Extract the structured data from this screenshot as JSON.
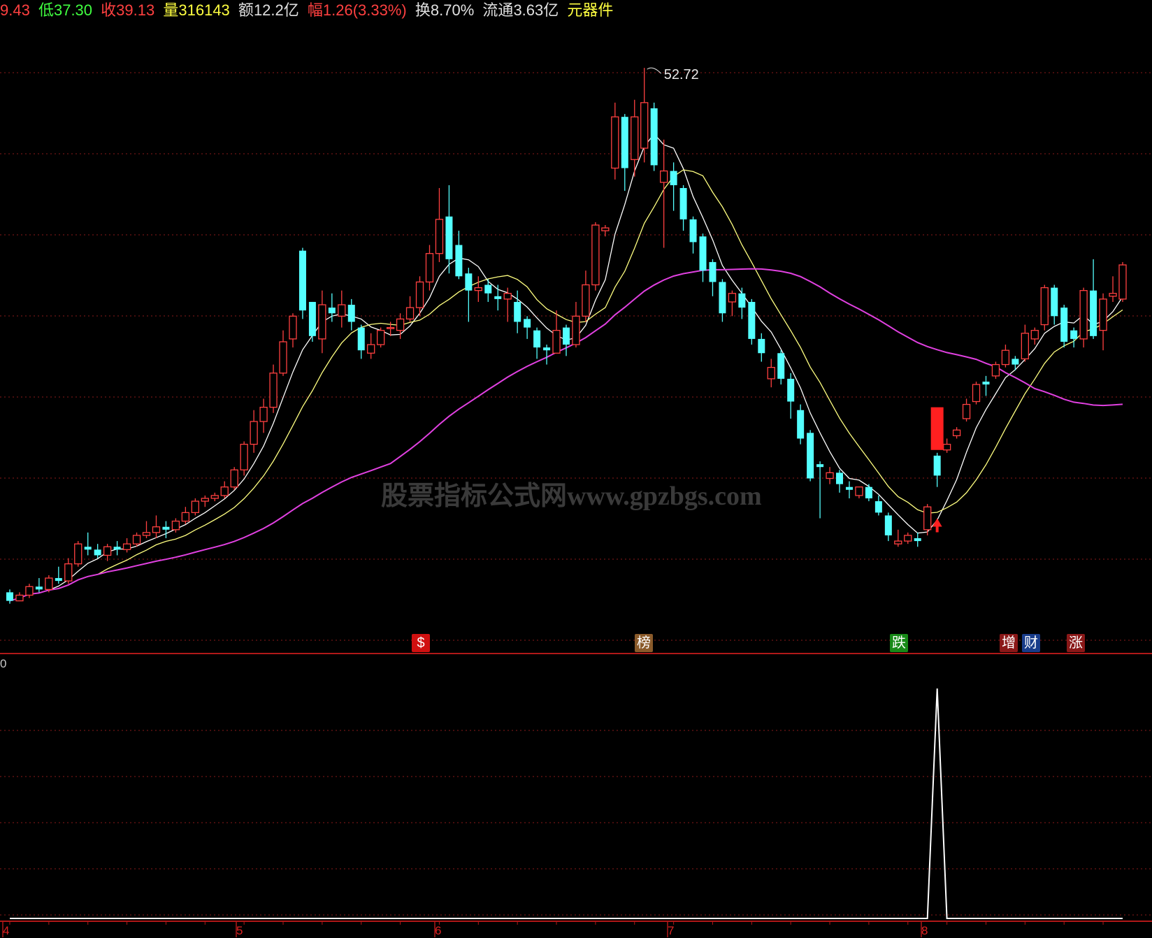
{
  "header": {
    "open_label": "9.43",
    "low_label": "低",
    "low_value": "37.30",
    "close_label": "收",
    "close_value": "39.13",
    "volume_label": "量",
    "volume_value": "316143",
    "amount_label": "额",
    "amount_value": "12.2亿",
    "change_label": "幅",
    "change_value": "1.26(3.33%)",
    "turnover_label": "换",
    "turnover_value": "8.70%",
    "float_label": "流通",
    "float_value": "3.63亿",
    "sector": "元器件"
  },
  "peak_label": "52.72",
  "watermark": "股票指标公式网www.gpzbgs.com",
  "event_badges": [
    {
      "text": "$",
      "color": "#d01010"
    },
    {
      "text": "榜",
      "color": "#8a5a2a"
    },
    {
      "text": "跌",
      "color": "#188a18"
    },
    {
      "text": "增",
      "color": "#8a1818"
    },
    {
      "text": "财",
      "color": "#183c8a"
    },
    {
      "text": "涨",
      "color": "#8a1818"
    }
  ],
  "lower_axis_label": "0",
  "colors": {
    "up": "#ff4040",
    "down": "#54ffff",
    "ma_short": "#ffffff",
    "ma_mid": "#ffff80",
    "ma_long": "#e040e0",
    "grid": "#8b1a1a",
    "indicator": "#ffffff"
  },
  "chart_data": [
    {
      "type": "candlestick",
      "title": "",
      "price_range": [
        33.5,
        54
      ],
      "x_labels": [
        "4",
        "5",
        "6",
        "7",
        "8"
      ],
      "grid": true,
      "candles": [
        [
          34.3,
          34.0,
          34.4,
          33.9
        ],
        [
          34.0,
          34.2,
          34.3,
          34.0
        ],
        [
          34.2,
          34.5,
          34.6,
          34.1
        ],
        [
          34.5,
          34.4,
          34.8,
          34.3
        ],
        [
          34.4,
          34.8,
          34.9,
          34.3
        ],
        [
          34.8,
          34.7,
          35.2,
          34.6
        ],
        [
          34.7,
          35.3,
          35.5,
          34.6
        ],
        [
          35.3,
          36.0,
          36.1,
          35.2
        ],
        [
          35.9,
          35.8,
          36.4,
          35.6
        ],
        [
          35.8,
          35.6,
          36.0,
          35.5
        ],
        [
          35.6,
          35.9,
          36.0,
          35.4
        ],
        [
          35.9,
          35.8,
          36.1,
          35.6
        ],
        [
          35.8,
          36.0,
          36.2,
          35.7
        ],
        [
          36.0,
          36.3,
          36.4,
          35.9
        ],
        [
          36.3,
          36.4,
          36.8,
          36.2
        ],
        [
          36.4,
          36.6,
          37.0,
          36.2
        ],
        [
          36.6,
          36.5,
          36.8,
          36.2
        ],
        [
          36.5,
          36.8,
          36.9,
          36.4
        ],
        [
          36.8,
          37.1,
          37.3,
          36.7
        ],
        [
          37.1,
          37.5,
          37.6,
          37.0
        ],
        [
          37.5,
          37.6,
          37.7,
          37.3
        ],
        [
          37.6,
          37.7,
          37.8,
          37.5
        ],
        [
          37.7,
          38.0,
          38.2,
          37.6
        ],
        [
          38.0,
          38.6,
          38.7,
          37.9
        ],
        [
          38.6,
          39.5,
          39.6,
          38.4
        ],
        [
          39.5,
          40.3,
          40.7,
          39.2
        ],
        [
          40.3,
          40.8,
          41.1,
          39.9
        ],
        [
          40.8,
          42.0,
          42.3,
          40.6
        ],
        [
          42.0,
          43.1,
          43.5,
          41.9
        ],
        [
          43.2,
          44.0,
          44.1,
          42.9
        ],
        [
          46.3,
          44.2,
          46.4,
          43.9
        ],
        [
          44.5,
          43.3,
          44.5,
          43.1
        ],
        [
          43.2,
          44.4,
          44.9,
          42.7
        ],
        [
          44.3,
          44.1,
          44.8,
          43.8
        ],
        [
          44.0,
          44.4,
          44.9,
          43.6
        ],
        [
          44.4,
          43.8,
          44.6,
          43.5
        ],
        [
          43.6,
          42.8,
          43.7,
          42.5
        ],
        [
          42.7,
          43.0,
          43.4,
          42.5
        ],
        [
          43.0,
          43.5,
          43.6,
          42.9
        ],
        [
          43.6,
          43.6,
          43.8,
          43.3
        ],
        [
          43.5,
          43.9,
          44.1,
          43.2
        ],
        [
          43.9,
          44.3,
          44.7,
          43.8
        ],
        [
          44.3,
          45.2,
          45.4,
          44.0
        ],
        [
          45.2,
          46.2,
          46.5,
          44.9
        ],
        [
          46.2,
          47.4,
          48.5,
          45.9
        ],
        [
          47.5,
          46.0,
          48.6,
          45.5
        ],
        [
          46.5,
          45.4,
          47.0,
          45.3
        ],
        [
          45.5,
          44.9,
          45.7,
          43.8
        ],
        [
          44.9,
          45.0,
          45.4,
          44.5
        ],
        [
          45.1,
          44.8,
          45.3,
          44.5
        ],
        [
          44.7,
          44.6,
          45.1,
          44.2
        ],
        [
          44.6,
          44.8,
          45.0,
          43.8
        ],
        [
          44.5,
          43.8,
          44.9,
          43.4
        ],
        [
          43.9,
          43.6,
          44.0,
          43.2
        ],
        [
          43.5,
          42.9,
          43.6,
          42.5
        ],
        [
          42.9,
          42.8,
          43.0,
          42.3
        ],
        [
          42.7,
          43.5,
          44.2,
          42.7
        ],
        [
          43.6,
          43.0,
          43.7,
          42.6
        ],
        [
          43.0,
          44.0,
          44.5,
          42.9
        ],
        [
          44.0,
          45.1,
          45.6,
          43.8
        ],
        [
          45.1,
          47.2,
          47.3,
          44.9
        ],
        [
          47.0,
          47.1,
          47.2,
          46.8
        ],
        [
          49.2,
          51.0,
          51.5,
          48.8
        ],
        [
          51.0,
          49.2,
          51.1,
          48.4
        ],
        [
          49.5,
          51.0,
          51.6,
          48.9
        ],
        [
          49.9,
          51.5,
          52.72,
          49.4
        ],
        [
          51.3,
          49.3,
          51.5,
          49.1
        ],
        [
          48.7,
          49.1,
          50.2,
          46.4
        ],
        [
          49.1,
          48.6,
          49.4,
          47.7
        ],
        [
          48.5,
          47.4,
          48.6,
          47.0
        ],
        [
          47.4,
          46.6,
          47.5,
          46.2
        ],
        [
          46.8,
          45.6,
          46.9,
          45.2
        ],
        [
          45.9,
          45.2,
          46.0,
          44.7
        ],
        [
          45.2,
          44.1,
          45.3,
          43.8
        ],
        [
          44.5,
          44.8,
          44.9,
          44.0
        ],
        [
          44.8,
          44.3,
          45.0,
          43.9
        ],
        [
          44.5,
          43.2,
          44.6,
          43.0
        ],
        [
          43.2,
          42.7,
          43.4,
          42.4
        ],
        [
          41.8,
          42.2,
          42.5,
          41.5
        ],
        [
          42.7,
          41.8,
          42.8,
          41.6
        ],
        [
          41.8,
          41.0,
          42.0,
          40.4
        ],
        [
          40.7,
          39.7,
          40.9,
          39.5
        ],
        [
          39.9,
          38.3,
          40.0,
          38.2
        ],
        [
          38.8,
          38.7,
          38.9,
          36.9
        ],
        [
          38.3,
          38.5,
          38.7,
          38.1
        ],
        [
          38.5,
          38.1,
          38.6,
          37.8
        ],
        [
          38.0,
          37.9,
          38.2,
          37.6
        ],
        [
          37.7,
          38.0,
          38.0,
          37.6
        ],
        [
          38.0,
          37.6,
          38.1,
          37.5
        ],
        [
          37.5,
          37.1,
          37.7,
          37.0
        ],
        [
          37.0,
          36.3,
          37.1,
          36.1
        ],
        [
          36.0,
          36.1,
          36.5,
          35.9
        ],
        [
          36.1,
          36.3,
          36.4,
          36.0
        ],
        [
          36.2,
          36.1,
          36.4,
          35.9
        ],
        [
          36.5,
          37.3,
          37.4,
          36.3
        ],
        [
          39.1,
          38.4,
          39.2,
          38.0
        ],
        [
          39.3,
          39.5,
          39.7,
          39.2
        ],
        [
          39.8,
          40.0,
          40.1,
          39.7
        ],
        [
          40.4,
          40.9,
          41.1,
          40.3
        ],
        [
          41.0,
          41.6,
          41.7,
          40.9
        ],
        [
          41.7,
          41.6,
          41.9,
          41.2
        ],
        [
          41.9,
          42.3,
          42.4,
          41.8
        ],
        [
          42.3,
          42.8,
          43.0,
          42.2
        ],
        [
          42.5,
          42.3,
          42.6,
          42.1
        ],
        [
          42.5,
          43.4,
          43.7,
          42.4
        ],
        [
          43.2,
          43.5,
          43.6,
          43.0
        ],
        [
          43.7,
          45.0,
          45.1,
          43.5
        ],
        [
          45.0,
          44.0,
          45.1,
          43.7
        ],
        [
          44.3,
          43.1,
          44.4,
          42.9
        ],
        [
          43.5,
          43.2,
          43.6,
          42.9
        ],
        [
          43.2,
          44.9,
          45.0,
          42.9
        ],
        [
          44.9,
          43.3,
          46.0,
          43.2
        ],
        [
          43.5,
          44.6,
          44.8,
          42.8
        ],
        [
          44.7,
          44.8,
          45.4,
          44.5
        ],
        [
          44.6,
          45.8,
          45.9,
          44.5
        ]
      ]
    },
    {
      "type": "line",
      "title": "",
      "ylim": [
        0,
        1
      ],
      "series": [
        {
          "values": [
            0,
            0,
            0,
            0,
            0,
            0,
            0,
            0,
            0,
            0,
            0,
            0,
            0,
            0,
            0,
            0,
            0,
            0,
            0,
            0,
            0,
            0,
            0,
            0,
            0,
            0,
            0,
            0,
            0,
            0,
            0,
            0,
            0,
            0,
            0,
            0,
            0,
            0,
            0,
            0,
            0,
            0,
            0,
            0,
            0,
            0,
            0,
            0,
            0,
            0,
            0,
            0,
            0,
            0,
            0,
            0,
            0,
            0,
            0,
            0,
            0,
            0,
            0,
            0,
            0,
            0,
            0,
            0,
            0,
            0,
            0,
            0,
            0,
            0,
            0,
            0,
            0,
            0,
            0,
            0,
            0,
            0,
            0,
            0,
            0,
            0,
            0,
            0,
            0,
            0,
            0,
            0,
            0,
            0,
            0,
            1,
            0,
            0,
            0,
            0,
            0,
            0,
            0,
            0,
            0,
            0,
            0,
            0,
            0,
            0,
            0,
            0,
            0,
            0,
            0
          ]
        }
      ]
    }
  ]
}
